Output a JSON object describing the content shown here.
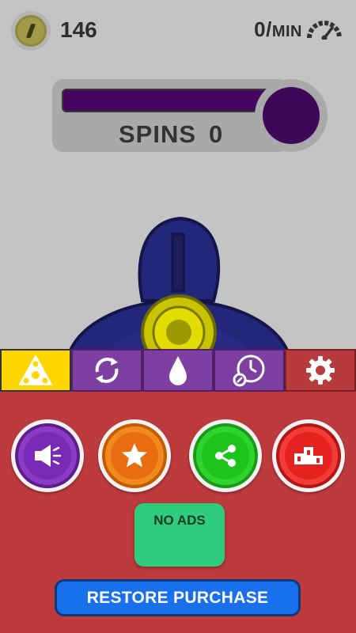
{
  "hud": {
    "coins": "146",
    "rate_value": "0/",
    "rate_unit": "MIN",
    "coin_icon": "coin-icon",
    "gauge_icon": "speedometer-icon"
  },
  "spins": {
    "label": "SPINS",
    "value": "0",
    "bar_color": "#45085e"
  },
  "tabs": [
    {
      "name": "fidget-tab",
      "icon": "fidget-spinner-icon",
      "color": "#ffd600",
      "selected": true
    },
    {
      "name": "rotate-tab",
      "icon": "rotate-icon",
      "color": "#7e3fa2",
      "selected": false
    },
    {
      "name": "drop-tab",
      "icon": "drop-icon",
      "color": "#7e3fa2",
      "selected": false
    },
    {
      "name": "timer-tab",
      "icon": "timer-icon",
      "color": "#7e3fa2",
      "selected": false
    },
    {
      "name": "settings-tab",
      "icon": "gear-icon",
      "color": "#b73a3d",
      "selected": false
    }
  ],
  "panel": {
    "buttons": [
      {
        "name": "sound-button",
        "icon": "speaker-icon"
      },
      {
        "name": "rate-button",
        "icon": "star-icon"
      },
      {
        "name": "share-button",
        "icon": "share-icon"
      },
      {
        "name": "leaderboard-button",
        "icon": "podium-icon"
      }
    ],
    "no_ads_label": "NO ADS",
    "restore_label": "RESTORE PURCHASE"
  }
}
